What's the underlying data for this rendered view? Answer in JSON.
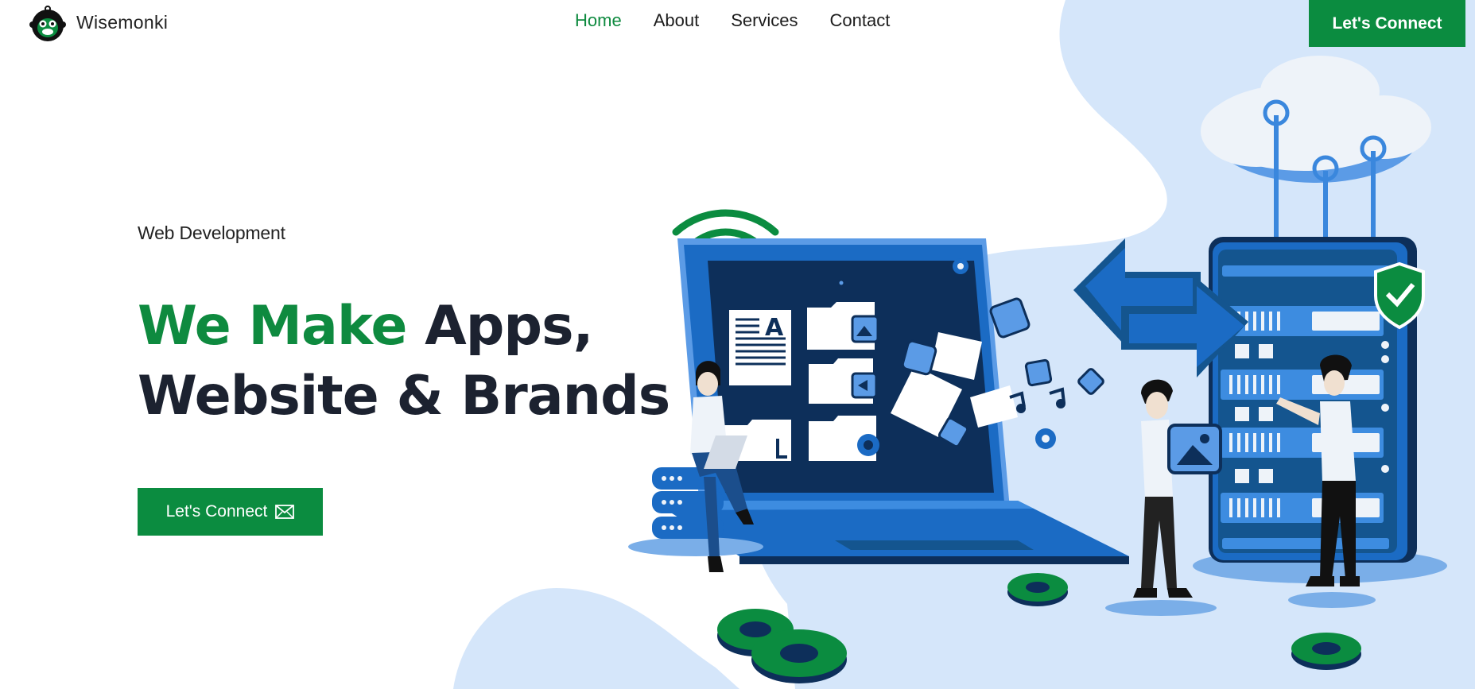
{
  "brand": {
    "name": "Wisemonki"
  },
  "nav": {
    "items": [
      "Home",
      "About",
      "Services",
      "Contact"
    ],
    "active": "Home"
  },
  "header": {
    "cta_label": "Let's Connect"
  },
  "hero": {
    "eyebrow": "Web Development",
    "headline_accent": "We Make",
    "headline_rest_1": " Apps,",
    "headline_line_2": "Website & Brands",
    "cta_label": "Let's Connect"
  },
  "colors": {
    "brand_green": "#0b8c40",
    "accent_green": "#0e8a3f",
    "text_dark": "#1c2230",
    "illustration_blue": "#1b6bc4",
    "bg_blue": "#d5e6fa"
  },
  "illustration": {
    "icons": [
      "wifi-icon",
      "laptop",
      "cloud-icon",
      "server-rack",
      "shield-check-icon",
      "gear-icon",
      "arrows-exchange",
      "image-file-icon",
      "database-icon",
      "music-note-icon"
    ]
  }
}
